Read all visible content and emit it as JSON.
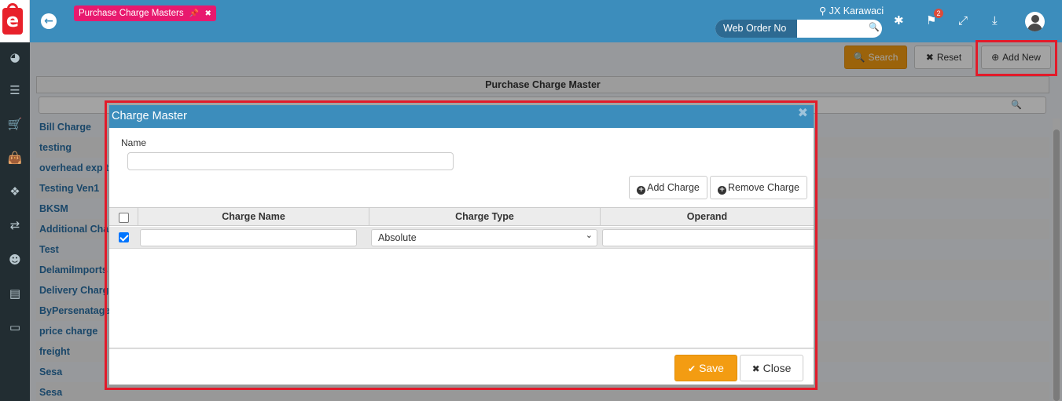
{
  "header": {
    "tab_label": "Purchase Charge Masters",
    "location": "JX Karawaci",
    "search_type": "Web Order No",
    "search_value": "",
    "notification_count": "2"
  },
  "sidebar": {
    "items": [
      {
        "icon": "dashboard-icon"
      },
      {
        "icon": "list-icon"
      },
      {
        "icon": "cart-icon"
      },
      {
        "icon": "shopping-bag-icon"
      },
      {
        "icon": "cubes-icon"
      },
      {
        "icon": "exchange-icon"
      },
      {
        "icon": "user-plus-icon"
      },
      {
        "icon": "book-icon"
      },
      {
        "icon": "credit-card-icon"
      }
    ]
  },
  "toolbar": {
    "search_label": "Search",
    "reset_label": "Reset",
    "add_new_label": "Add New"
  },
  "grid": {
    "title": "Purchase Charge Master",
    "rows": [
      "Bill Charge",
      "testing",
      "overhead exp t",
      "Testing Ven1",
      "BKSM",
      "Additional Cha",
      "Test",
      "DelamiImports",
      "Delivery Charg",
      "ByPersenatage",
      "price charge",
      "freight",
      "Sesa",
      "Sesa"
    ]
  },
  "modal": {
    "title": "Charge Master",
    "name_label": "Name",
    "name_value": "",
    "add_charge_label": "Add Charge",
    "remove_charge_label": "Remove Charge",
    "columns": [
      "Charge Name",
      "Charge Type",
      "Operand"
    ],
    "rows": [
      {
        "checked": true,
        "charge_name": "",
        "charge_type": "Absolute",
        "operand": ""
      }
    ],
    "save_label": "Save",
    "close_label": "Close"
  },
  "colors": {
    "header_blue": "#3c8dbc",
    "sidebar_dark": "#222d32",
    "tab_pink": "#e8196e",
    "warning_orange": "#f39c12",
    "highlight_red": "#e21b2a"
  }
}
